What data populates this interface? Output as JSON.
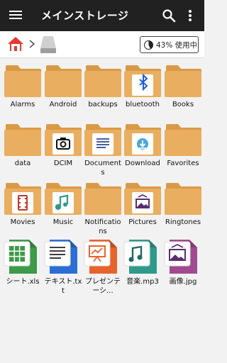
{
  "appbar": {
    "title": "メインストレージ"
  },
  "storage": {
    "usage_text": "43% 使用中",
    "used_fraction": 0.43
  },
  "items": [
    {
      "label": "Alarms"
    },
    {
      "label": "Android"
    },
    {
      "label": "backups"
    },
    {
      "label": "bluetooth"
    },
    {
      "label": "Books"
    },
    {
      "label": "data"
    },
    {
      "label": "DCIM"
    },
    {
      "label": "Documents"
    },
    {
      "label": "Download"
    },
    {
      "label": "Favorites"
    },
    {
      "label": "Movies"
    },
    {
      "label": "Music"
    },
    {
      "label": "Notifications"
    },
    {
      "label": "Pictures"
    },
    {
      "label": "Ringtones"
    },
    {
      "label": "シート.xls"
    },
    {
      "label": "テキスト.txt"
    },
    {
      "label": "プレゼンテーシ..."
    },
    {
      "label": "音楽.mp3"
    },
    {
      "label": "画像.jpg"
    }
  ],
  "colors": {
    "folder": "#e9ae5f",
    "folder_dark": "#d99a47",
    "sheet": "#3d9a48",
    "text": "#2c6fd4",
    "presentation": "#e8632b",
    "music": "#2f9a8c",
    "image": "#a24a90"
  }
}
